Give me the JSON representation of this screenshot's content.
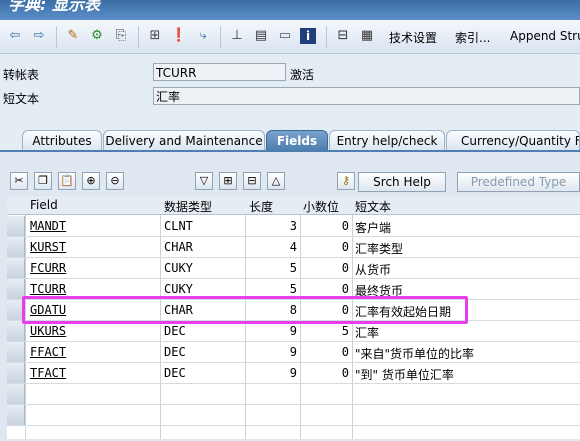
{
  "window": {
    "title": "字典: 显示表"
  },
  "toolbar": {
    "tech_settings": "技术设置",
    "index": "索引...",
    "append": "Append Stru"
  },
  "fields": {
    "table_label": "转帐表",
    "table_value": "TCURR",
    "status": "激活",
    "short_text_label": "短文本",
    "short_text_value": "汇率"
  },
  "tabs": [
    {
      "label": "Attributes"
    },
    {
      "label": "Delivery and Maintenance"
    },
    {
      "label": "Fields"
    },
    {
      "label": "Entry help/check"
    },
    {
      "label": "Currency/Quantity Fie"
    }
  ],
  "buttons": {
    "srch_help": "Srch Help",
    "predefined_type": "Predefined Type"
  },
  "grid": {
    "headers": {
      "field": "Field",
      "type": "数据类型",
      "length": "长度",
      "decimals": "小数位",
      "desc": "短文本"
    },
    "rows": [
      {
        "field": "MANDT",
        "type": "CLNT",
        "length": "3",
        "decimals": "0",
        "desc": "客户端"
      },
      {
        "field": "KURST",
        "type": "CHAR",
        "length": "4",
        "decimals": "0",
        "desc": "汇率类型"
      },
      {
        "field": "FCURR",
        "type": "CUKY",
        "length": "5",
        "decimals": "0",
        "desc": "从货币"
      },
      {
        "field": "TCURR",
        "type": "CUKY",
        "length": "5",
        "decimals": "0",
        "desc": "最终货币"
      },
      {
        "field": "GDATU",
        "type": "CHAR",
        "length": "8",
        "decimals": "0",
        "desc": "汇率有效起始日期"
      },
      {
        "field": "UKURS",
        "type": "DEC",
        "length": "9",
        "decimals": "5",
        "desc": "汇率"
      },
      {
        "field": "FFACT",
        "type": "DEC",
        "length": "9",
        "decimals": "0",
        "desc": "\"来自\"货币单位的比率"
      },
      {
        "field": "TFACT",
        "type": "DEC",
        "length": "9",
        "decimals": "0",
        "desc": "\"到\" 货币单位汇率"
      }
    ]
  }
}
